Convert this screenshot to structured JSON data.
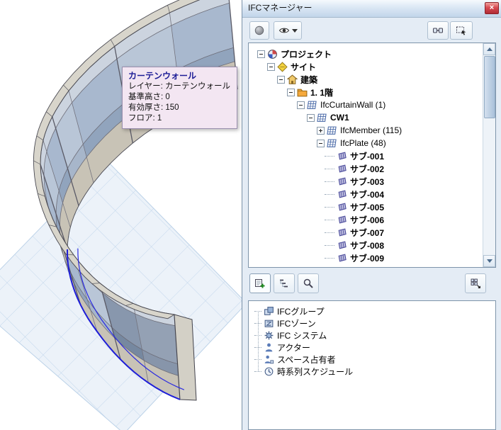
{
  "scene": {
    "tooltip": {
      "title": "カーテンウォール",
      "lines": [
        "レイヤー: カーテンウォール",
        "基準高さ: 0",
        "有効厚さ: 150",
        "フロア: 1"
      ]
    }
  },
  "panel": {
    "title": "IFCマネージャー",
    "close_label": "×",
    "toolbar_top": {
      "buttons": [
        {
          "name": "status-sphere-button",
          "icon": "sphere-icon"
        },
        {
          "name": "visibility-button",
          "icon": "eye-icon"
        },
        {
          "name": "model-link-button",
          "icon": "link-icon"
        },
        {
          "name": "selection-rect-button",
          "icon": "selection-rect-icon"
        }
      ]
    },
    "tree": {
      "items": [
        {
          "label": "プロジェクト",
          "level": 0,
          "expand": "minus",
          "icon": "project",
          "bold": true
        },
        {
          "label": "サイト",
          "level": 1,
          "expand": "minus",
          "icon": "site",
          "bold": true
        },
        {
          "label": "建築",
          "level": 2,
          "expand": "minus",
          "icon": "building",
          "bold": true
        },
        {
          "label": "1. 1階",
          "level": 3,
          "expand": "minus",
          "icon": "floor",
          "bold": true
        },
        {
          "label": "IfcCurtainWall (1)",
          "level": 4,
          "expand": "minus",
          "icon": "curtainwall",
          "bold": false
        },
        {
          "label": "CW1",
          "level": 5,
          "expand": "minus",
          "icon": "curtainwall",
          "bold": true
        },
        {
          "label": "IfcMember (115)",
          "level": 6,
          "expand": "plus",
          "icon": "curtainwall",
          "bold": false
        },
        {
          "label": "IfcPlate (48)",
          "level": 6,
          "expand": "minus",
          "icon": "curtainwall",
          "bold": false
        },
        {
          "label": "サブ-001",
          "level": 7,
          "expand": "leaf",
          "icon": "subplate",
          "bold": true
        },
        {
          "label": "サブ-002",
          "level": 7,
          "expand": "leaf",
          "icon": "subplate",
          "bold": true
        },
        {
          "label": "サブ-003",
          "level": 7,
          "expand": "leaf",
          "icon": "subplate",
          "bold": true
        },
        {
          "label": "サブ-004",
          "level": 7,
          "expand": "leaf",
          "icon": "subplate",
          "bold": true
        },
        {
          "label": "サブ-005",
          "level": 7,
          "expand": "leaf",
          "icon": "subplate",
          "bold": true
        },
        {
          "label": "サブ-006",
          "level": 7,
          "expand": "leaf",
          "icon": "subplate",
          "bold": true
        },
        {
          "label": "サブ-007",
          "level": 7,
          "expand": "leaf",
          "icon": "subplate",
          "bold": true
        },
        {
          "label": "サブ-008",
          "level": 7,
          "expand": "leaf",
          "icon": "subplate",
          "bold": true
        },
        {
          "label": "サブ-009",
          "level": 7,
          "expand": "leaf",
          "icon": "subplate",
          "bold": true
        }
      ]
    },
    "toolbar_mid": {
      "buttons": [
        {
          "name": "new-item-button",
          "icon": "add-icon"
        },
        {
          "name": "hierarchy-button",
          "icon": "hierarchy-icon"
        },
        {
          "name": "search-button",
          "icon": "magnifier-icon"
        },
        {
          "name": "assign-button",
          "icon": "matrix-icon"
        }
      ]
    },
    "types": {
      "items": [
        {
          "label": "IFCグループ",
          "icon": "group"
        },
        {
          "label": "IFCゾーン",
          "icon": "zone"
        },
        {
          "label": "IFC システム",
          "icon": "system"
        },
        {
          "label": "アクター",
          "icon": "actor"
        },
        {
          "label": "スペース占有者",
          "icon": "occupant"
        },
        {
          "label": "時系列スケジュール",
          "icon": "schedule"
        }
      ]
    }
  }
}
